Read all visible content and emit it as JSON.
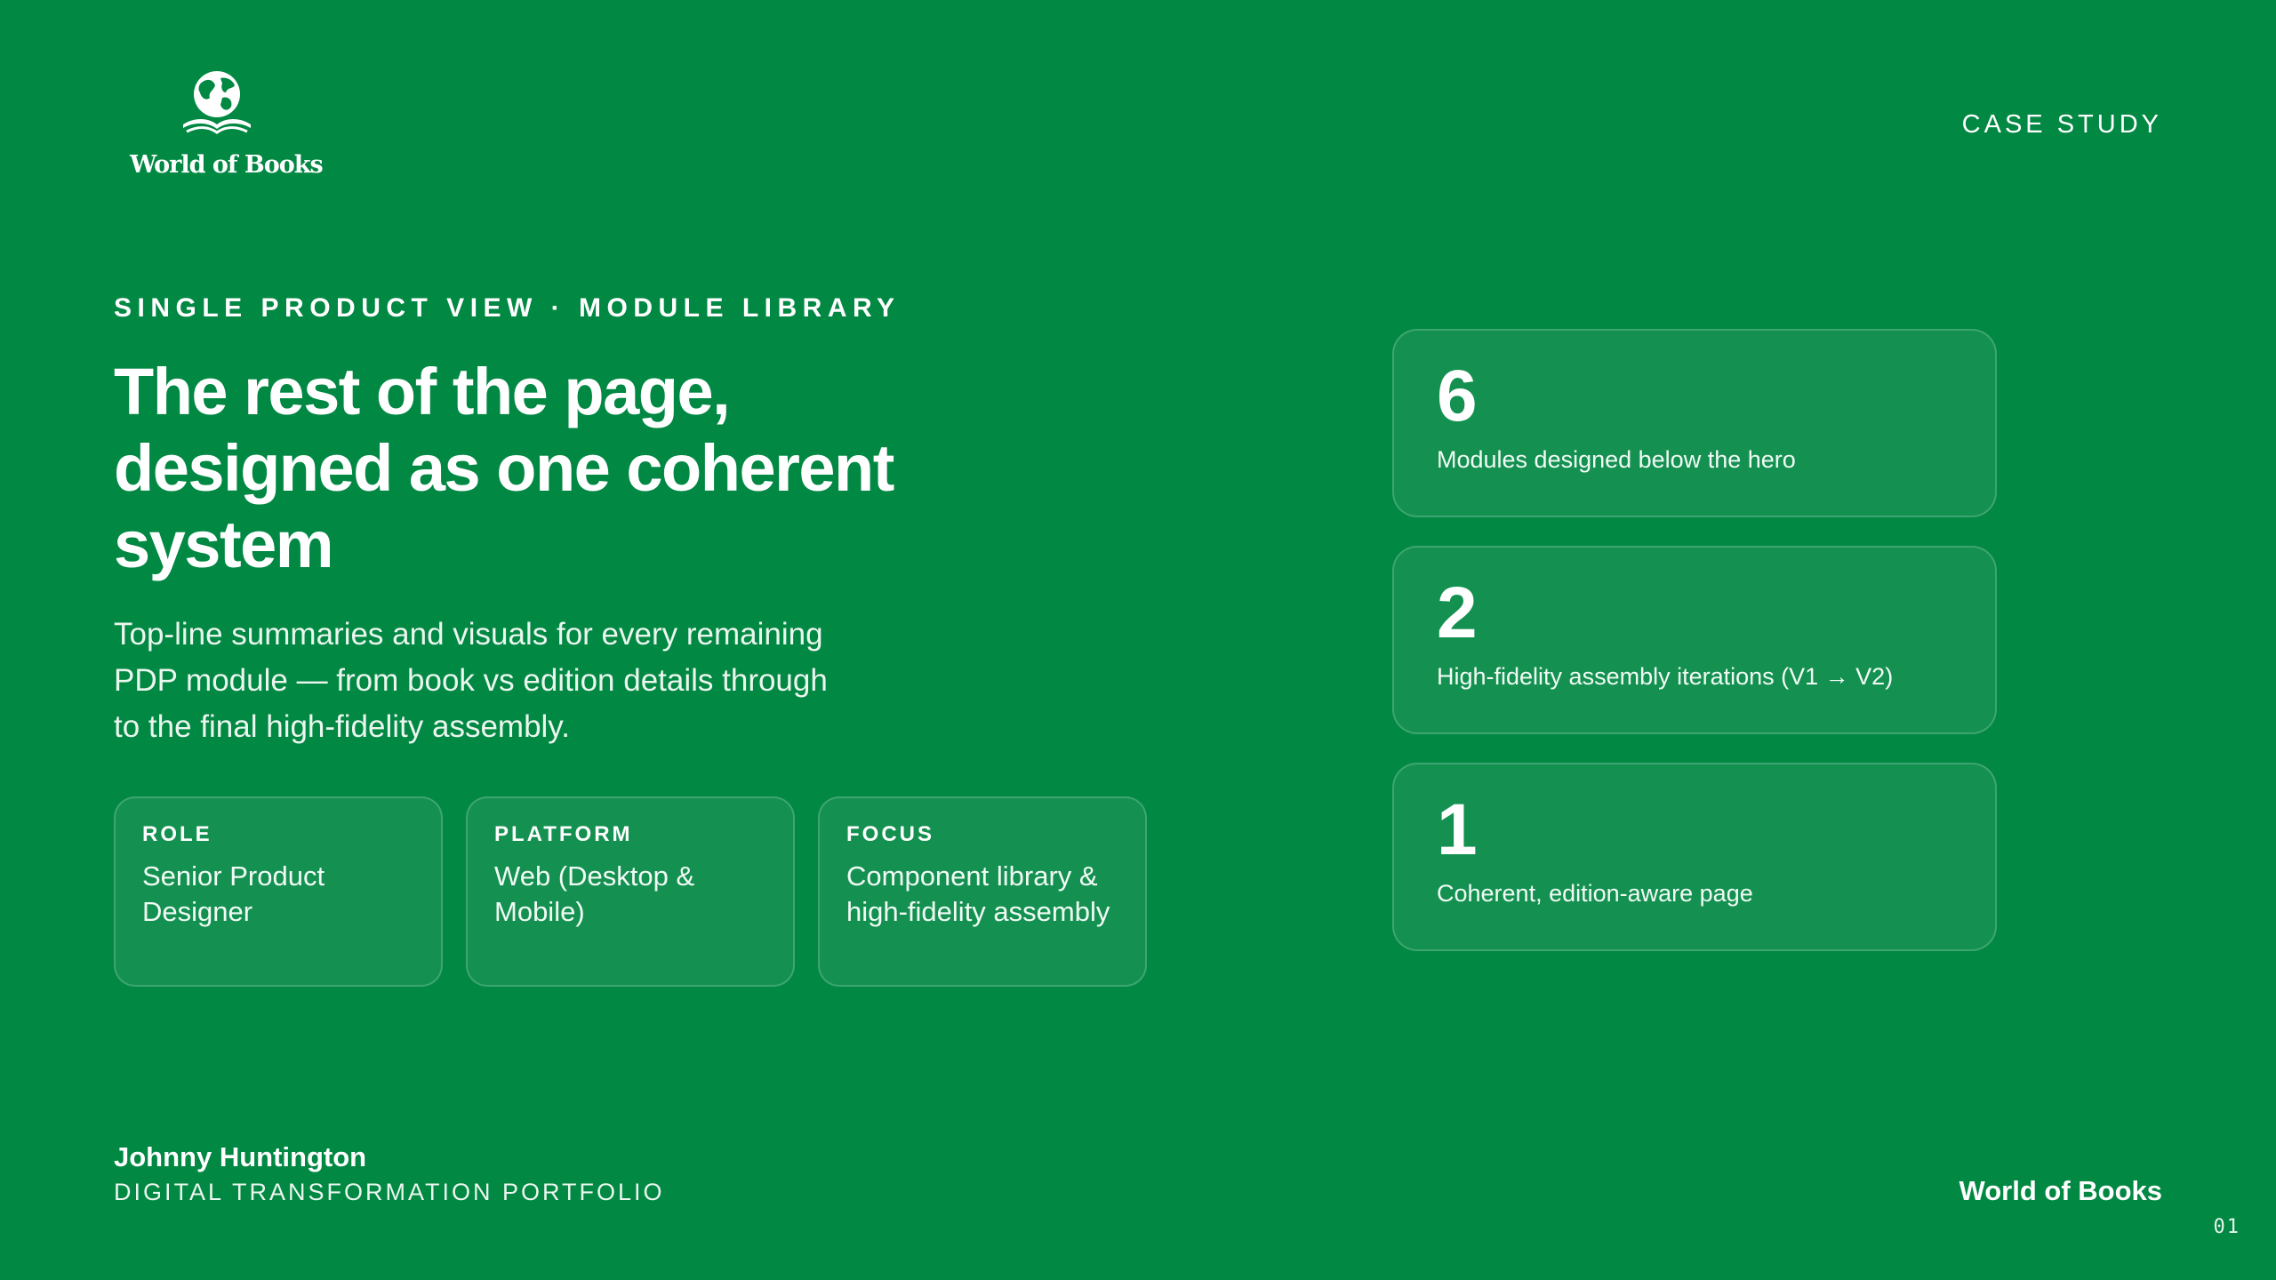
{
  "brand": {
    "logo_icon": "globe-book-icon",
    "logo_text": "World of Books"
  },
  "header": {
    "tag": "CASE STUDY"
  },
  "hero": {
    "eyebrow": "SINGLE PRODUCT VIEW · MODULE LIBRARY",
    "headline": "The rest of the page, designed as one coherent system",
    "lede": "Top-line summaries and visuals for every remaining PDP module — from book vs edition details through to the final high-fidelity assembly."
  },
  "meta": [
    {
      "label": "ROLE",
      "value": "Senior Product Designer"
    },
    {
      "label": "PLATFORM",
      "value": "Web (Desktop & Mobile)"
    },
    {
      "label": "FOCUS",
      "value": "Component library & high-fidelity assembly"
    }
  ],
  "stats": [
    {
      "number": "6",
      "text": "Modules designed below the hero"
    },
    {
      "number": "2",
      "text": "High-fidelity assembly iterations (V1 → V2)"
    },
    {
      "number": "1",
      "text": "Coherent, edition-aware page"
    }
  ],
  "footer": {
    "author_name": "Johnny Huntington",
    "author_subtitle": "DIGITAL TRANSFORMATION PORTFOLIO",
    "brand": "World of Books",
    "page_number": "01"
  },
  "colors": {
    "background": "#018843",
    "text": "#ffffff"
  }
}
